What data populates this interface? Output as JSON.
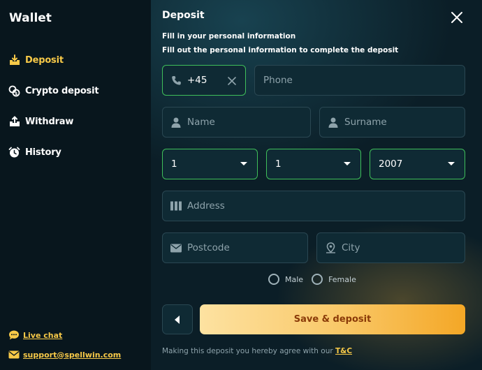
{
  "sidebar": {
    "title": "Wallet",
    "items": [
      {
        "label": "Deposit",
        "icon": "deposit-icon",
        "active": true
      },
      {
        "label": "Crypto deposit",
        "icon": "crypto-icon",
        "active": false
      },
      {
        "label": "Withdraw",
        "icon": "withdraw-icon",
        "active": false
      },
      {
        "label": "History",
        "icon": "clock-icon",
        "active": false
      }
    ],
    "live_chat": "Live chat",
    "support_email": "support@spellwin.com"
  },
  "colors": {
    "accent": "#f7c948",
    "valid_border": "#3fbf5a",
    "button_start": "#fde2a1",
    "button_end": "#f4a726",
    "button_text": "#8a3a08"
  },
  "panel": {
    "title": "Deposit",
    "subtitle1": "Fill in your personal information",
    "subtitle2": "Fill out the personal information to complete the deposit",
    "phone_code": "+45",
    "phone_placeholder": "Phone",
    "name_placeholder": "Name",
    "surname_placeholder": "Surname",
    "day_value": "1",
    "month_value": "1",
    "year_value": "2007",
    "address_placeholder": "Address",
    "postcode_placeholder": "Postcode",
    "city_placeholder": "City",
    "gender_male": "Male",
    "gender_female": "Female",
    "save_label": "Save & deposit",
    "terms_text": "Making this deposit you hereby agree with our",
    "terms_link": "T&C"
  }
}
